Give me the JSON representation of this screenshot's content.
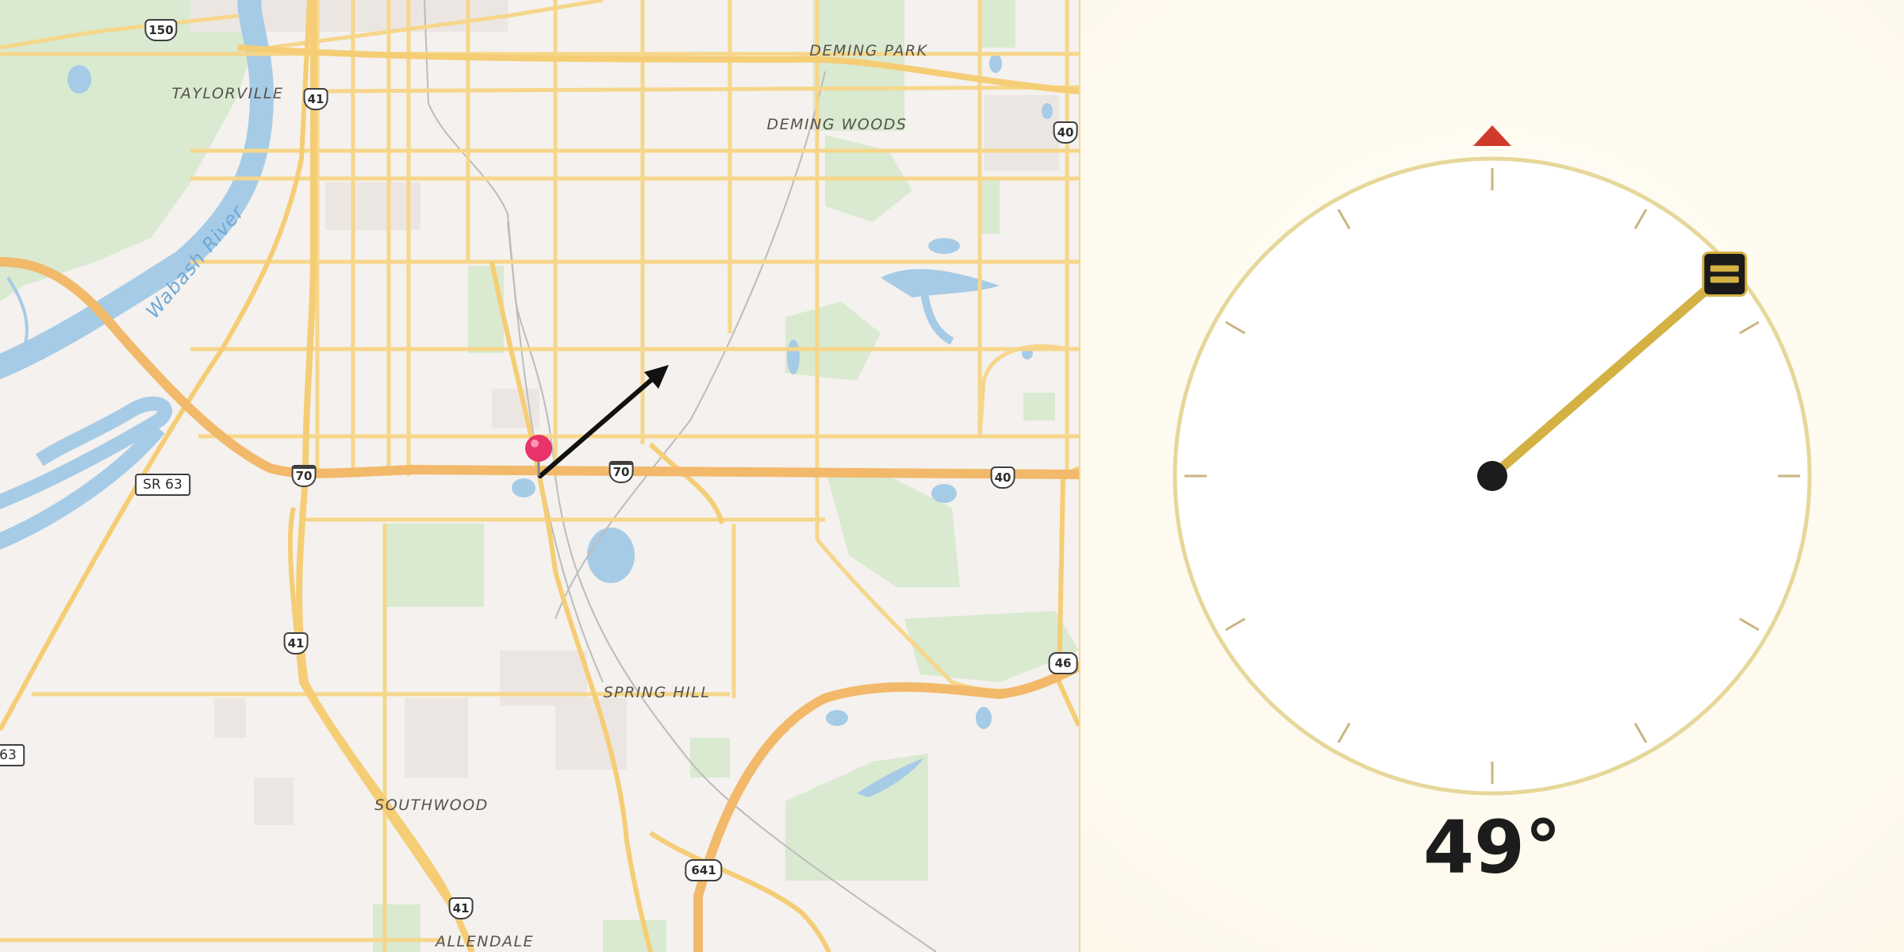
{
  "map": {
    "places": [
      {
        "id": "deming-park",
        "text": "DEMING PARK"
      },
      {
        "id": "taylorville",
        "text": "TAYLORVILLE"
      },
      {
        "id": "deming-woods",
        "text": "DEMING WOODS"
      },
      {
        "id": "spring-hill",
        "text": "SPRING HILL"
      },
      {
        "id": "southwood",
        "text": "SOUTHWOOD"
      },
      {
        "id": "allendale",
        "text": "ALLENDALE"
      }
    ],
    "river_label": "Wabash River",
    "shields": {
      "us150": "150",
      "us41_north": "41",
      "us40_east": "40",
      "sr63": "SR 63",
      "i70_west": "70",
      "i70_east": "70",
      "us40_center": "40",
      "us41_south": "41",
      "us41_bottom": "41",
      "r46": "46",
      "r63": "63",
      "r641": "641"
    },
    "pin_icon": "map-pin-icon",
    "heading_arrow_icon": "heading-arrow-icon"
  },
  "compass": {
    "heading_deg": 49,
    "heading_text": "49°",
    "north_marker_icon": "north-triangle-icon",
    "needle_handle_icon": "needle-handle-icon",
    "colors": {
      "ring": "#e6d79a",
      "needle": "#d3b143",
      "north_marker": "#d03a2a",
      "pivot": "#1c1c1c"
    }
  }
}
